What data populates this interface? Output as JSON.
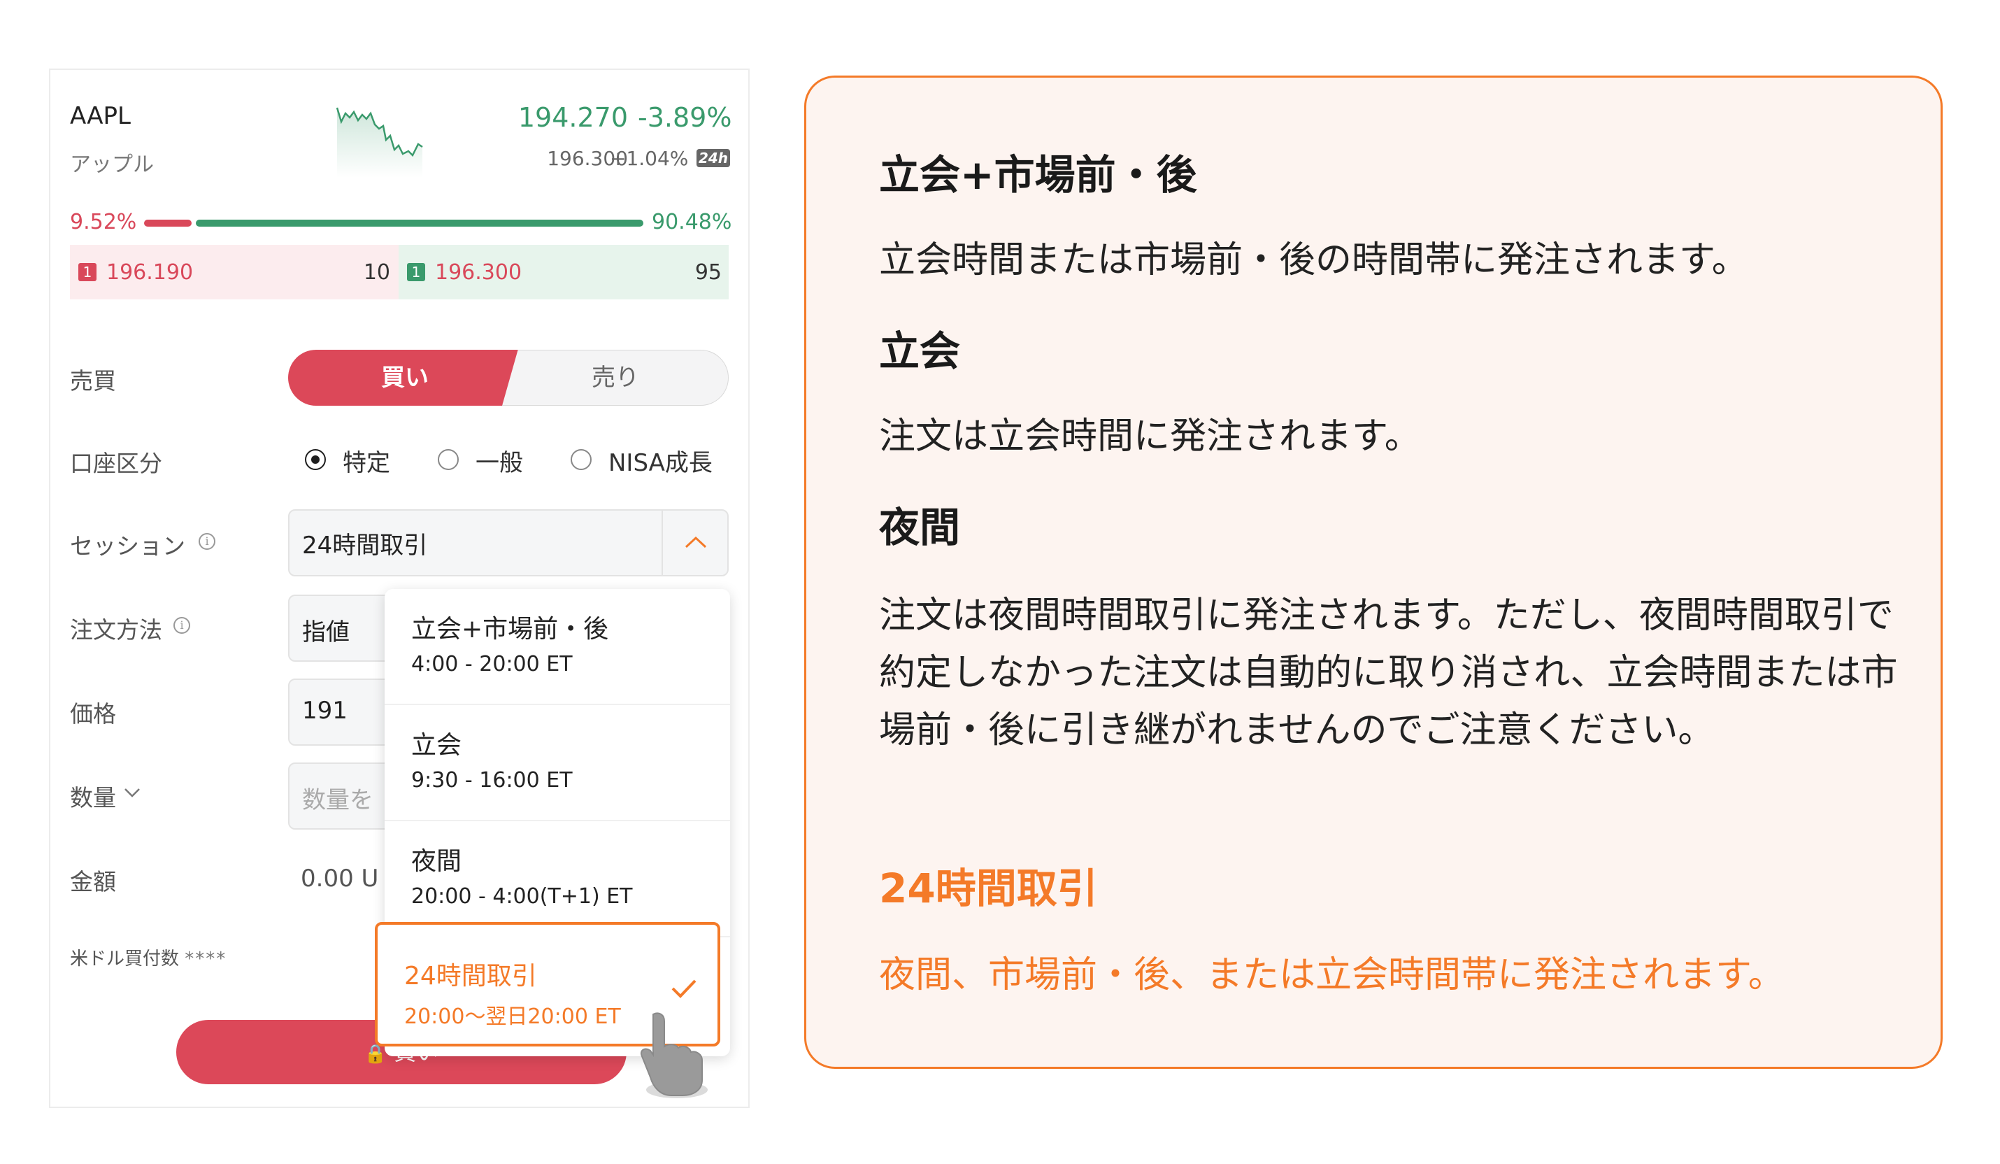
{
  "stock": {
    "ticker": "AAPL",
    "company": "アップル",
    "price": "194.270",
    "change_pct": "-3.89%",
    "prev_price": "196.300",
    "ext_change_pct": "+1.04%",
    "ext_badge": "24h"
  },
  "order_book": {
    "sell_ratio": "9.52%",
    "buy_ratio": "90.48%",
    "sell_ratio_value": 9.52,
    "buy_ratio_value": 90.48,
    "bid": {
      "level": "1",
      "price": "196.190",
      "qty": "10"
    },
    "ask": {
      "level": "1",
      "price": "196.300",
      "qty": "95"
    }
  },
  "form": {
    "side_label": "売買",
    "buy_label": "買い",
    "sell_label": "売り",
    "account_label": "口座区分",
    "accounts": [
      "特定",
      "一般",
      "NISA成長"
    ],
    "selected_account": "特定",
    "session_label": "セッション",
    "session_value": "24時間取引",
    "method_label": "注文方法",
    "method_value": "指値",
    "price_label": "価格",
    "price_value": "191",
    "qty_label": "数量",
    "qty_placeholder": "数量を",
    "amount_label": "金額",
    "amount_value": "0.00 U",
    "buying_power_label": "米ドル買付数",
    "buying_power_value": "****",
    "submit_label": "買い"
  },
  "session_dropdown": {
    "options": [
      {
        "name": "立会+市場前・後",
        "time": "4:00 - 20:00 ET"
      },
      {
        "name": "立会",
        "time": "9:30 - 16:00 ET"
      },
      {
        "name": "夜間",
        "time": "20:00 - 4:00(T+1) ET"
      },
      {
        "name": "24時間取引",
        "time": "20:00〜翌日20:00 ET"
      }
    ],
    "selected": "24時間取引"
  },
  "explanation": {
    "sections": [
      {
        "title": "立会+市場前・後",
        "text": "立会時間または市場前・後の時間帯に発注されます。"
      },
      {
        "title": "立会",
        "text": "注文は立会時間に発注されます。"
      },
      {
        "title": "夜間",
        "text": "注文は夜間時間取引に発注されます。ただし、夜間時間取引で約定しなかった注文は自動的に取り消され、立会時間または市場前・後に引き継がれませんのでご注意ください。"
      },
      {
        "title": "24時間取引",
        "text": "夜間、市場前・後、または立会時間帯に発注されます。"
      }
    ]
  },
  "colors": {
    "accent": "#f47a28",
    "buy_red": "#dc4859",
    "up_green": "#3a9a6c"
  }
}
